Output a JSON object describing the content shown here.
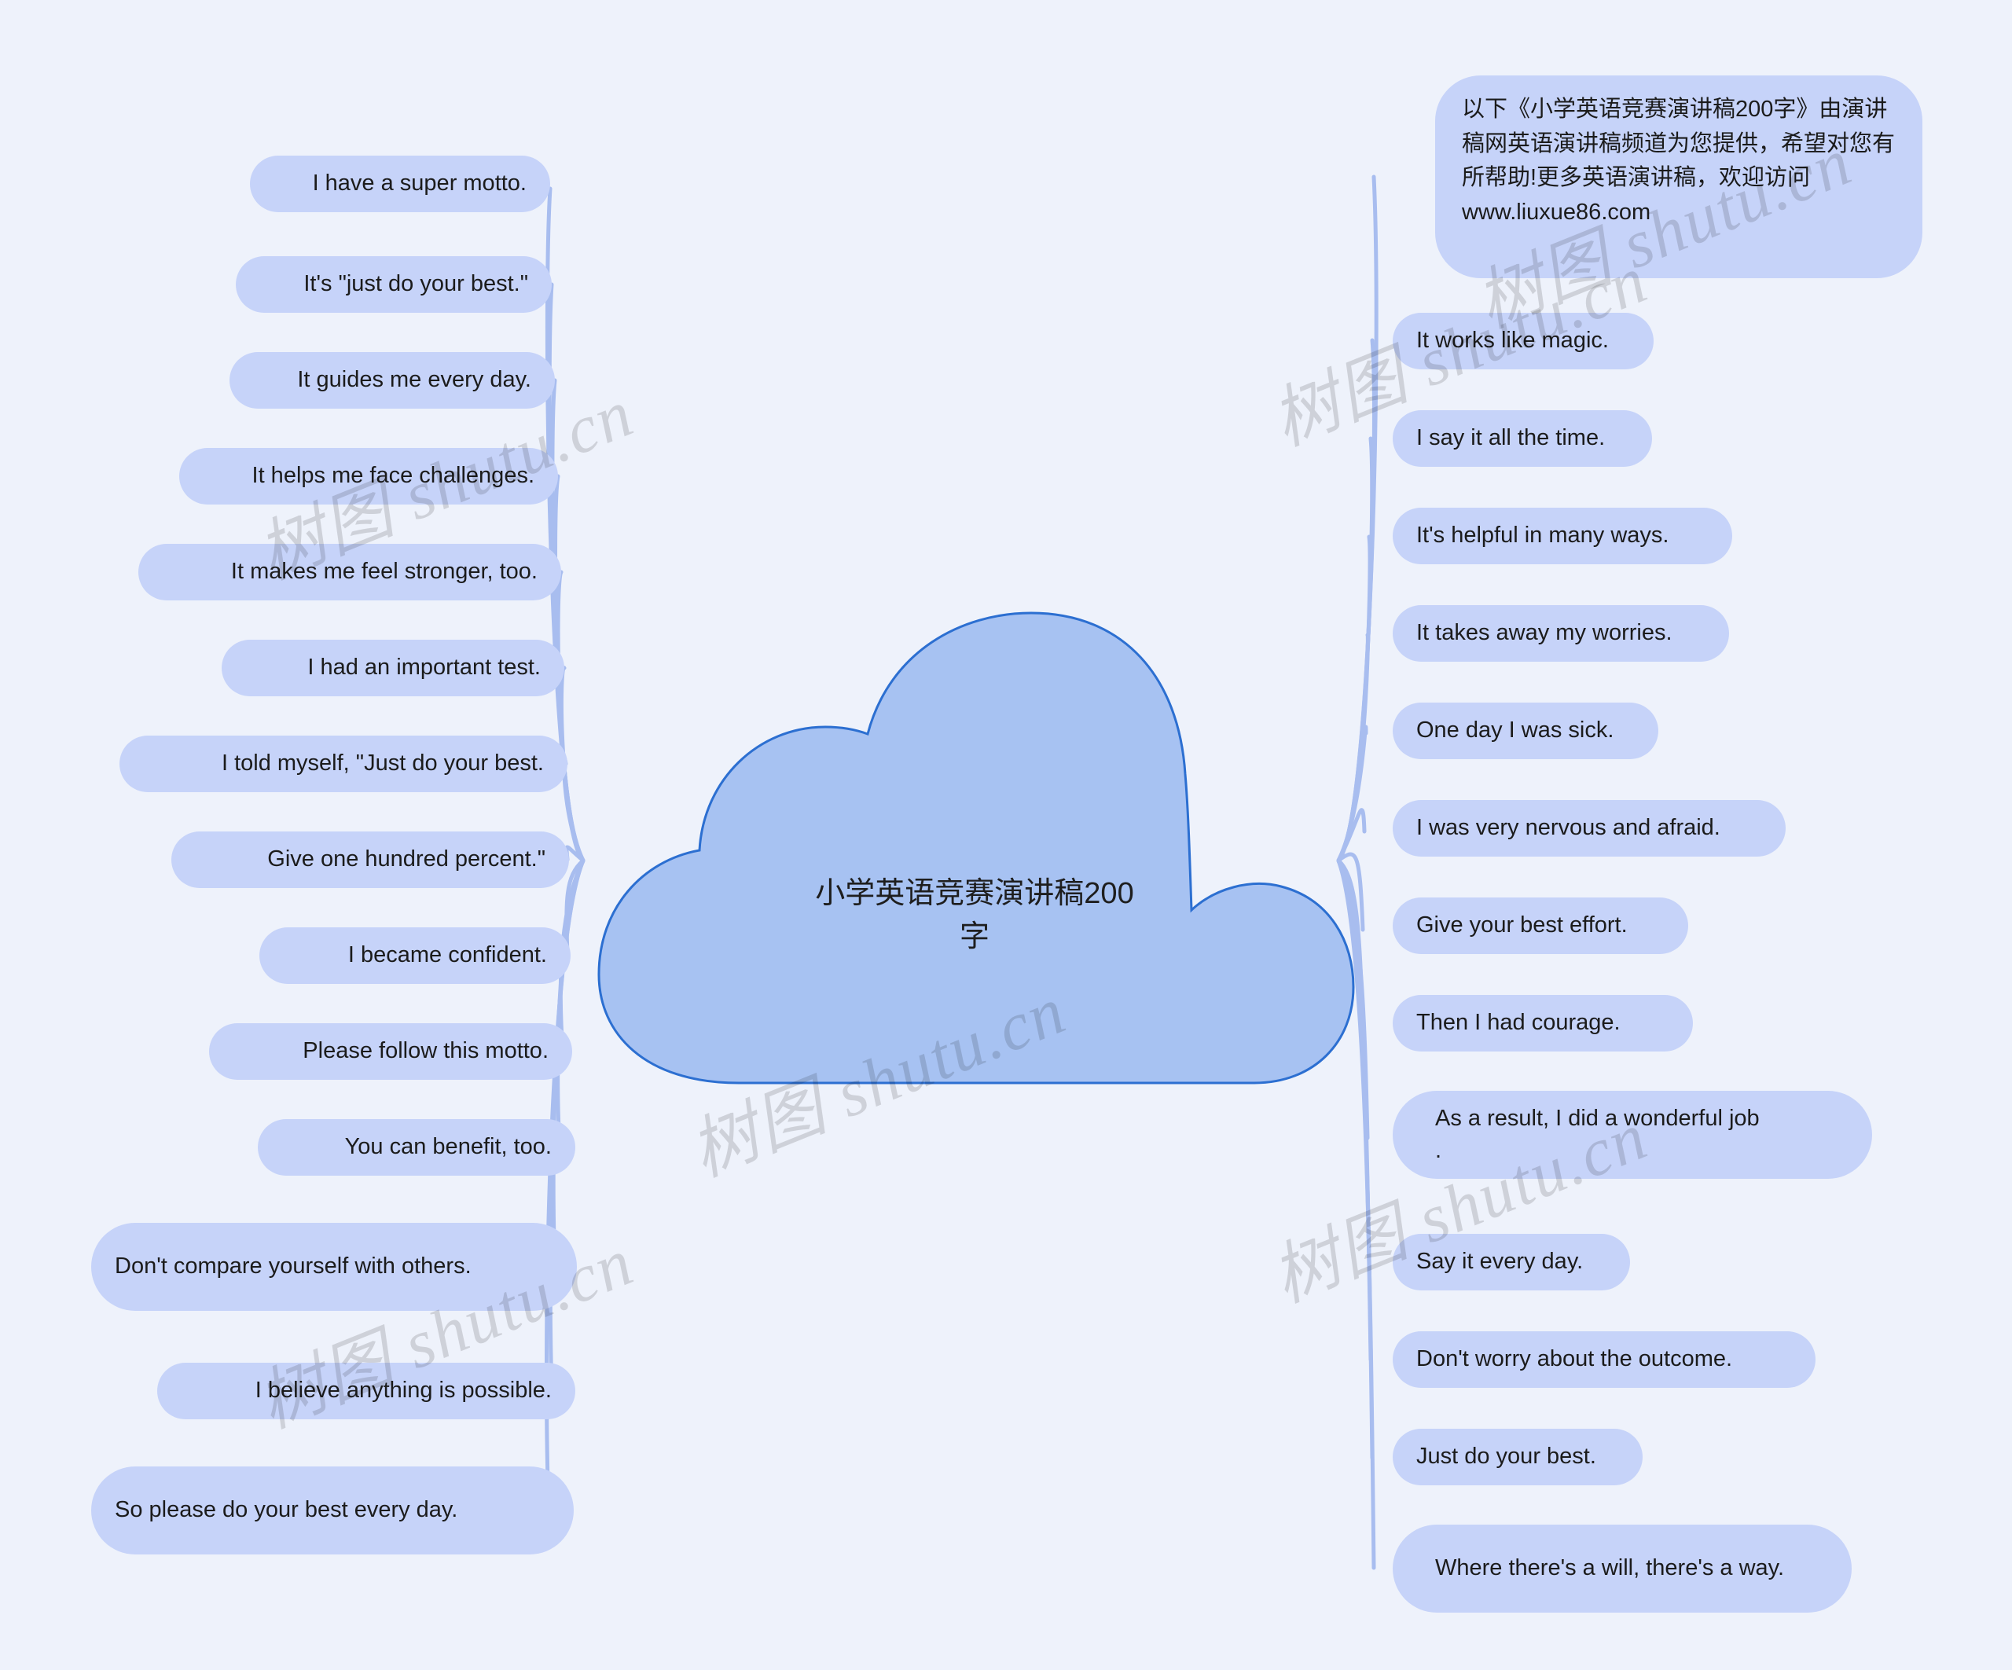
{
  "diagram": {
    "type": "mind-map",
    "background_color": "#eef2fb",
    "node_fill_color": "#c6d3f9",
    "cloud_fill_color": "#a7c2f2",
    "cloud_stroke_color": "#2c6fd1",
    "edge_color": "#a8bdef",
    "text_color": "#1b1b1b"
  },
  "watermark": {
    "text_cn": "树图 shutu.cn",
    "occurrences": 6
  },
  "center": {
    "title": "小学英语竞赛演讲稿200\n字",
    "shape": "cloud"
  },
  "left_branch": {
    "items": [
      {
        "label": "I have a super motto."
      },
      {
        "label": "It's \"just do your best.\""
      },
      {
        "label": "It guides me every day."
      },
      {
        "label": "It helps me face challenges."
      },
      {
        "label": "It makes me feel stronger, too."
      },
      {
        "label": "I had an important test."
      },
      {
        "label": "I told myself, \"Just do your best."
      },
      {
        "label": "Give one hundred percent.\""
      },
      {
        "label": "I became confident."
      },
      {
        "label": "Please follow this motto."
      },
      {
        "label": "You can benefit, too."
      },
      {
        "label": "Don't compare yourself with others."
      },
      {
        "label": "I believe anything is possible."
      },
      {
        "label": "So please do your best every day."
      }
    ]
  },
  "right_branch": {
    "items": [
      {
        "label": "以下《小学英语竞赛演讲稿200字》由演讲稿网英语演讲稿频道为您提供，希望对您有所帮助!更多英语演讲稿，欢迎访问www.liuxue86.com"
      },
      {
        "label": "It works like magic."
      },
      {
        "label": "I say it all the time."
      },
      {
        "label": "It's helpful in many ways."
      },
      {
        "label": "It takes away my worries."
      },
      {
        "label": "One day I was sick."
      },
      {
        "label": "I was very nervous and afraid."
      },
      {
        "label": "Give your best effort."
      },
      {
        "label": "Then I had courage."
      },
      {
        "label": "As a result, I did a wonderful job\n."
      },
      {
        "label": "Say it every day."
      },
      {
        "label": "Don't worry about the outcome."
      },
      {
        "label": "Just do your best."
      },
      {
        "label": "Where there's a will, there's a way."
      }
    ]
  }
}
